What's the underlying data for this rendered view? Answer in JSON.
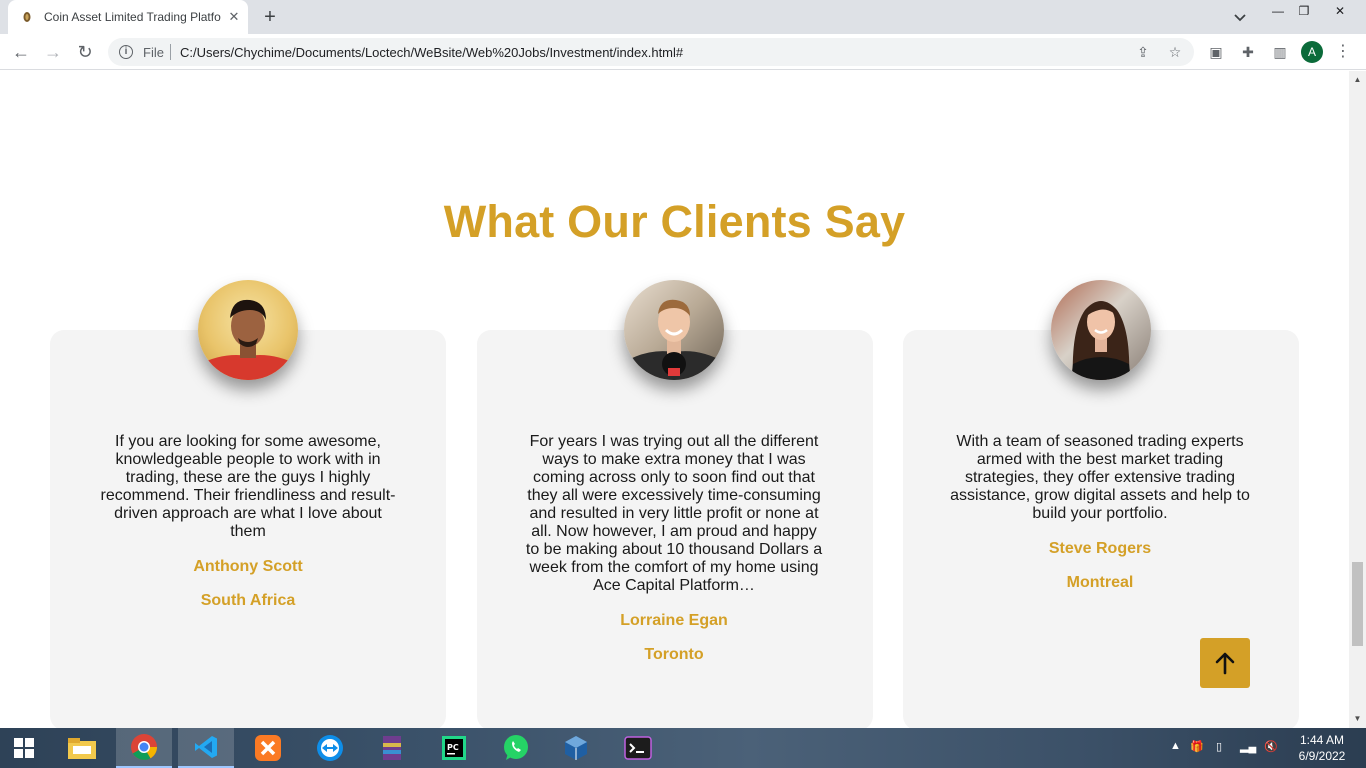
{
  "browser": {
    "tab_title": "Coin Asset Limited Trading Platfo",
    "file_label": "File",
    "url": "C:/Users/Chychime/Documents/Loctech/WeBsite/Web%20Jobs/Investment/index.html#",
    "profile_initial": "A"
  },
  "section": {
    "title": "What Our Clients Say"
  },
  "testimonials": [
    {
      "quote": "If you are looking for some awesome, knowledgeable people to work with in trading, these are the guys I highly recommend. Their friendliness and result-driven approach are what I love about them",
      "name": "Anthony Scott",
      "location": "South Africa"
    },
    {
      "quote": "For years I was trying out all the different ways to make extra money that I was coming across only to soon find out that they all were excessively time-consuming and resulted in very little profit or none at all. Now however, I am proud and happy to be making about 10 thousand Dollars a week from the comfort of my home using Ace Capital Platform…",
      "name": "Lorraine Egan",
      "location": "Toronto"
    },
    {
      "quote": "With a team of seasoned trading experts armed with the best market trading strategies, they offer extensive trading assistance, grow digital assets and help to build your portfolio.",
      "name": "Steve Rogers",
      "location": "Montreal"
    }
  ],
  "taskbar": {
    "time": "1:44 AM",
    "date": "6/9/2022"
  },
  "colors": {
    "accent": "#d4a027",
    "card_bg": "#f4f4f4"
  }
}
